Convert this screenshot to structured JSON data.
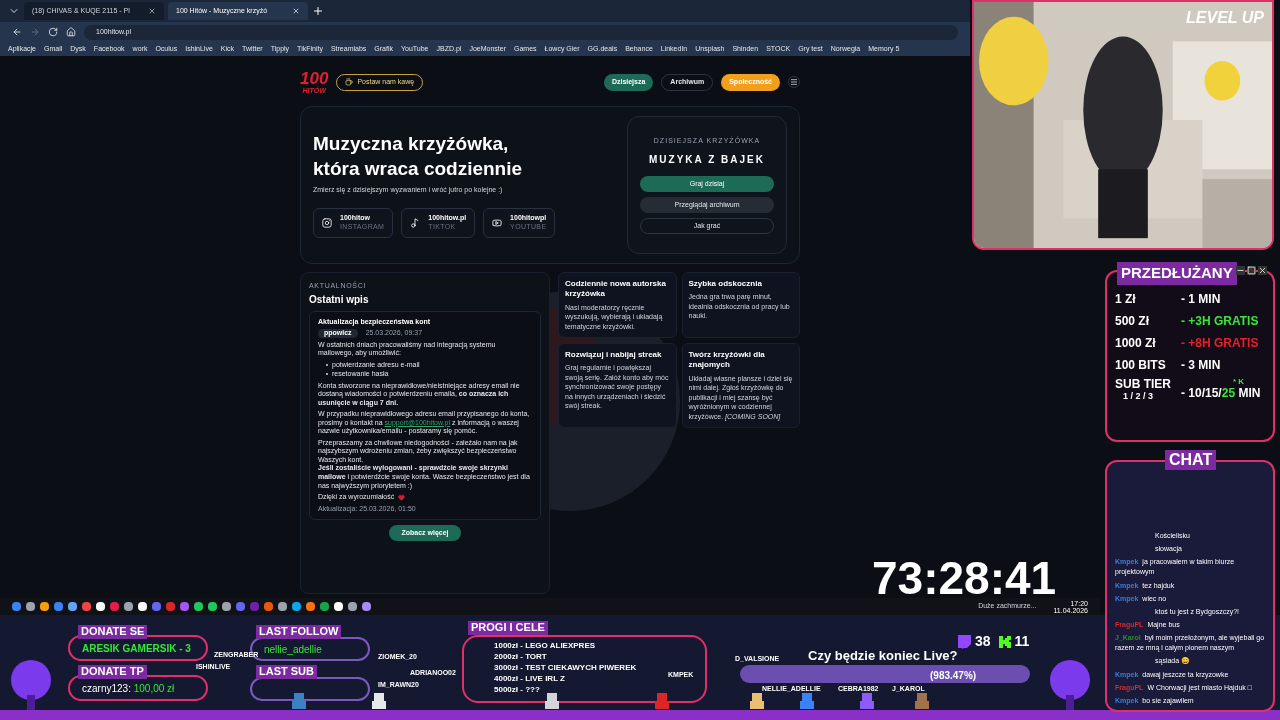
{
  "browser": {
    "tabs": [
      {
        "title": "(18) CHIVAS & KUQE 2115 - Pl",
        "selected": false
      },
      {
        "title": "100 Hitów - Muzyczne krzyżó",
        "selected": true
      }
    ],
    "url": "100hitow.pl",
    "bookmarks": [
      "Aplikacje",
      "Gmail",
      "Dysk",
      "Facebook",
      "work",
      "Oculus",
      "IshinLive",
      "Kick",
      "Twitter",
      "Tipply",
      "TikFinity",
      "Streamlabs",
      "Grafik",
      "YouTube",
      "JBZD.pl",
      "JoeMonster",
      "Games",
      "Łowcy Gier",
      "GG.deals",
      "Behance",
      "LinkedIn",
      "Unsplash",
      "Shinden",
      "STOCK",
      "Gry test",
      "Norwegia",
      "Memory 5"
    ]
  },
  "site": {
    "logo": "100",
    "logo_sub": "HITÓW",
    "coffee_button": "Postaw nam kawę",
    "nav": [
      {
        "label": "Dzisiejsza",
        "kind": "primary"
      },
      {
        "label": "Archiwum",
        "kind": "outline"
      },
      {
        "label": "Społeczność",
        "kind": "accent"
      }
    ],
    "hero": {
      "title": [
        "Muzyczna krzyżówka,",
        "która wraca codziennie"
      ],
      "subtitle": "Zmierz się z dzisiejszym wyzwaniem i wróć jutro po kolejne :)",
      "socials": [
        {
          "handle": "100hitow",
          "platform": "INSTAGRAM",
          "kind": "instagram"
        },
        {
          "handle": "100hitow.pl",
          "platform": "TIKTOK",
          "kind": "tiktok"
        },
        {
          "handle": "100hitowpl",
          "platform": "YOUTUBE",
          "kind": "youtube"
        }
      ],
      "today": {
        "eyebrow": "DZISIEJSZA KRZYŻÓWKA",
        "name": "MUZYKA Z BAJEK",
        "buttons": [
          {
            "label": "Graj dzisiaj",
            "kind": "primary"
          },
          {
            "label": "Przeglądaj archiwum",
            "kind": "secondary"
          },
          {
            "label": "Jak grać",
            "kind": "outline"
          }
        ]
      }
    },
    "news": {
      "eyebrow": "AKTUALNOŚCI",
      "title": "Ostatni wpis",
      "post": {
        "title": "Aktualizacja bezpieczeństwa kont",
        "author": "ppowicz",
        "date": "25.03.2026, 09:37",
        "intro": "W ostatnich dniach pracowaliśmy nad integracją systemu mailowego, aby umożliwić:",
        "bullets": [
          "potwierdzanie adresu e-mail",
          "resetowanie hasła"
        ],
        "warning": "Konta stworzone na nieprawidłowe/nieistniejące adresy email nie dostaną wiadomości o potwierdzeniu emaila, **co oznacza ich usunięcie w ciągu 7 dni.**",
        "contact": {
          "before": "W przypadku nieprawidłowego adresu email przypisanego do konta, prosimy o kontakt na",
          "link": "support@100hitow.pl",
          "after": "z informacją o waszej nazwie użytkownika/emailu - postaramy się pomóc."
        },
        "apology": "Przepraszamy za chwilowe niedogodności - zależało nam na jak najszybszym wdrożeniu zmian, żeby zwiększyć bezpieczeństwo Waszych kont.",
        "logout": "**Jeśli zostaliście wylogowani - sprawdźcie swoje skrzynki mailowe** i potwierdźcie swoje konta. Wasze bezpieczeństwo jest dla nas najwyższym priorytetem :)",
        "thanks": "Dzięki za wyrozumiałość",
        "updated": "Aktualizacja: 25.03.2026, 01:50"
      },
      "see_more": "Zobacz więcej"
    },
    "features": [
      {
        "title": "Codziennie nowa autorska krzyżówka",
        "text": "Nasi moderatorzy ręcznie wyszukują, wybierają i układają tematyczne krzyżówki."
      },
      {
        "title": "Szybka odskocznia",
        "text": "Jedna gra trwa parę minut, idealnia odskocznia od pracy lub nauki."
      },
      {
        "title": "Rozwiązuj i nabijaj streak",
        "text": "Graj regularnie i powiększaj swoją serię. Załóż konto aby móc synchronizować swoje postępy na innych urządzeniach i śledzić swój streak."
      },
      {
        "title": "Twórz krzyżówki dla znajomych",
        "text": "Układaj własne plansze i dziel się nimi dalej. Zgłoś krzyżówkę do publikacji i miej szansę być wyróżnionym w codziennej krzyżówce. *[COMING SOON]*"
      }
    ]
  },
  "taskbar": {
    "weather": "Duże zachmurze...",
    "time": "17:20",
    "date": "11.04.2026"
  },
  "overlay": {
    "webcam": {
      "kind": "picture",
      "badge": "LEVEL UP"
    },
    "timer": "73:28:41",
    "rates": {
      "title": "PRZEDŁUŻANY",
      "rows": [
        {
          "amount": "1 Zł",
          "reward": "- 1 MIN",
          "color": "#ffffff"
        },
        {
          "amount": "500 Zł",
          "reward": "- +3H GRATIS",
          "color": "#39e639"
        },
        {
          "amount": "1000 Zł",
          "reward": "- +8H GRATIS",
          "color": "#e8202a"
        },
        {
          "amount": "100 BITS",
          "reward": "- 3 MIN",
          "color": "#ffffff"
        }
      ],
      "sub": {
        "amount": "SUB TIER",
        "tiers": "1 / 2 / 3",
        "reward": "- 10/15/",
        "highlight": "25",
        "unit": "MIN",
        "note": "* K"
      }
    },
    "chat": {
      "title": "CHAT",
      "messages": [
        {
          "text": "Kościelisku"
        },
        {
          "text": "słowacja"
        },
        {
          "user": "Kmpek",
          "text": "ja pracowałem w takim biurze projektowym",
          "color": "#3b7dd8"
        },
        {
          "user": "Kmpek",
          "text": "tez hajduk",
          "color": "#3b7dd8"
        },
        {
          "user": "Kmpek",
          "text": "wiec no",
          "color": "#3b7dd8"
        },
        {
          "text": "ktoś tu jest z Bydgoszczy?!"
        },
        {
          "user": "FraguPL",
          "text": "Majne bus",
          "color": "#d42a2a"
        },
        {
          "user": "J_Karol",
          "text": "był moim przełożonym, ale wyjebali go razem ze mną i całym pionem naszym",
          "color": "#2e8b2e"
        },
        {
          "text": "sąsiada 😄"
        },
        {
          "user": "Kmpek",
          "text": "dawaj jeszcze ta krzyzowke",
          "color": "#3b7dd8"
        },
        {
          "user": "FraguPL",
          "text": "W Chorwacji jest miasto Hajduk □",
          "color": "#d42a2a"
        },
        {
          "user": "Kmpek",
          "text": "bo sie zajawilem",
          "color": "#3b7dd8"
        }
      ]
    },
    "donate_se": {
      "label": "DONATE SE",
      "value": "ARESIK GAMERSIK - 3"
    },
    "donate_tp": {
      "label": "DONATE TP",
      "name": "czarny123:",
      "amount": "100,00 zł"
    },
    "last_follow": {
      "label": "LAST FOLLOW",
      "value": "nellie_adellie"
    },
    "last_sub": {
      "label": "LAST SUB"
    },
    "goals": {
      "title": "PROGI I CELE",
      "items": [
        "1000zł - LEGO ALIEXPRES",
        "2000zł - TORT",
        "3000zł - TEST CIEKAWYCH PIWEREK",
        "4000zł - LIVE IRL Z",
        "5000zł - ???"
      ]
    },
    "poll": {
      "question": "Czy będzie koniec Live?",
      "progress": "(983.47%)",
      "level": 1
    },
    "viewers": {
      "twitch": "38",
      "kick": "11"
    },
    "characters": [
      "ZENGRABER",
      "ISHINLIVE",
      "ZIOMEK_20",
      "IM_RAWN20",
      "ADRIANOO02",
      "KMPEK",
      "D_VALSIONE",
      "NELLIE_ADELLIE",
      "CEBRA1982",
      "J_KAROL"
    ]
  }
}
